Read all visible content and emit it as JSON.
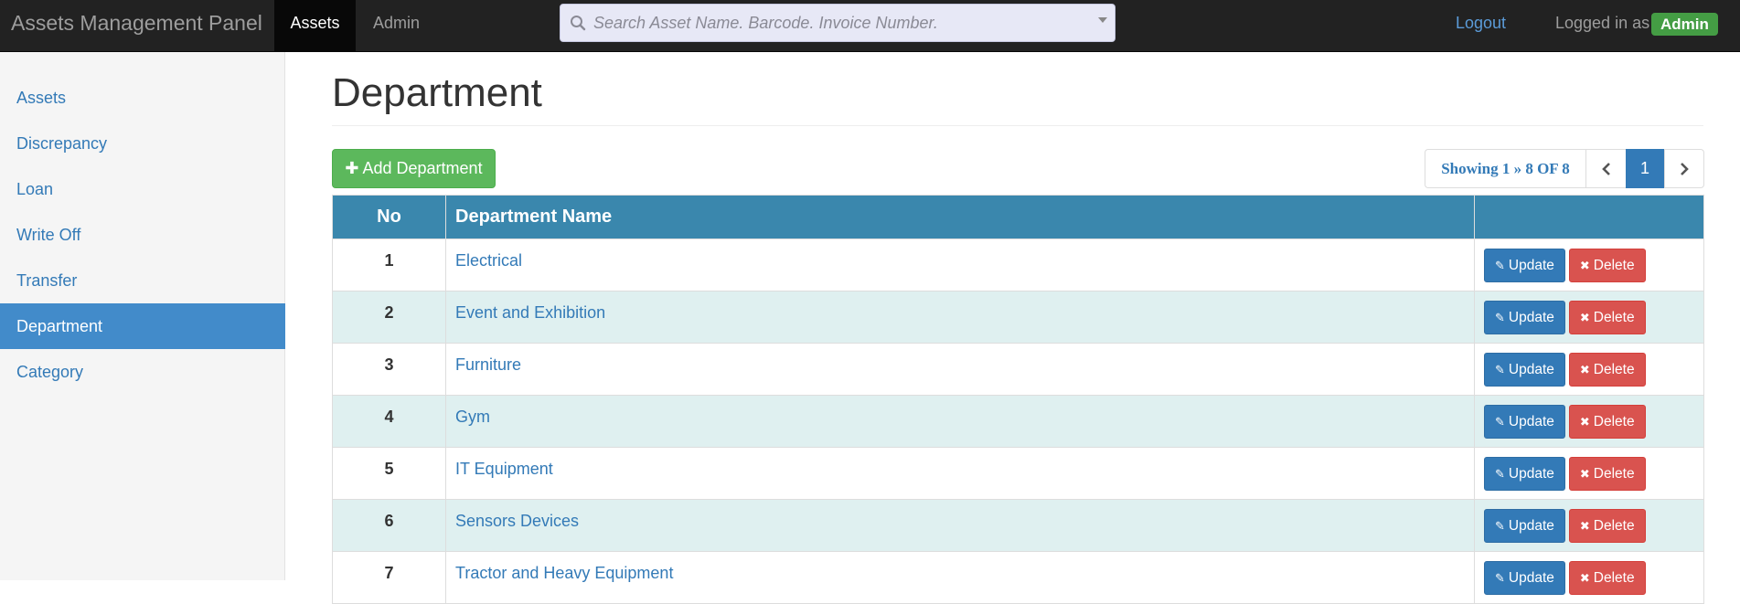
{
  "navbar": {
    "brand": "Assets Management Panel",
    "tabs": [
      {
        "label": "Assets",
        "active": true
      },
      {
        "label": "Admin",
        "active": false
      }
    ],
    "search_placeholder": "Search Asset Name. Barcode. Invoice Number.",
    "logout": "Logout",
    "logged_in_as": "Logged in as",
    "user_badge": "Admin"
  },
  "sidebar": {
    "items": [
      {
        "label": "Assets"
      },
      {
        "label": "Discrepancy"
      },
      {
        "label": "Loan"
      },
      {
        "label": "Write Off"
      },
      {
        "label": "Transfer"
      },
      {
        "label": "Department",
        "active": true
      },
      {
        "label": "Category"
      }
    ]
  },
  "main": {
    "title": "Department",
    "add_button": "Add Department",
    "pagination": {
      "info": "Showing 1 » 8 OF 8",
      "current_page": "1"
    },
    "table": {
      "headers": {
        "no": "No",
        "name": "Department Name",
        "actions": ""
      },
      "update_label": "Update",
      "delete_label": "Delete",
      "rows": [
        {
          "no": "1",
          "name": "Electrical"
        },
        {
          "no": "2",
          "name": "Event and Exhibition"
        },
        {
          "no": "3",
          "name": "Furniture"
        },
        {
          "no": "4",
          "name": "Gym"
        },
        {
          "no": "5",
          "name": "IT Equipment"
        },
        {
          "no": "6",
          "name": "Sensors Devices"
        },
        {
          "no": "7",
          "name": "Tractor and Heavy Equipment"
        }
      ]
    }
  },
  "colors": {
    "navbar_bg": "#222222",
    "sidebar_active": "#428bca",
    "table_header": "#3a87ad",
    "row_stripe": "#dff0f0",
    "success": "#5cb85c",
    "primary": "#337ab7",
    "danger": "#d9534f"
  }
}
